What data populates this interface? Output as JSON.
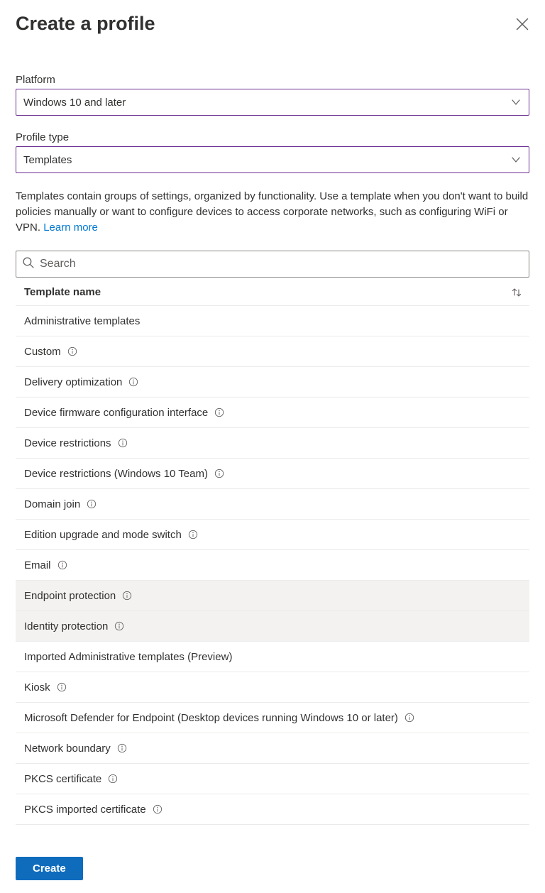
{
  "header": {
    "title": "Create a profile"
  },
  "fields": {
    "platform_label": "Platform",
    "platform_value": "Windows 10 and later",
    "profile_type_label": "Profile type",
    "profile_type_value": "Templates"
  },
  "description": {
    "text": "Templates contain groups of settings, organized by functionality. Use a template when you don't want to build policies manually or want to configure devices to access corporate networks, such as configuring WiFi or VPN. ",
    "learn_more": "Learn more"
  },
  "search": {
    "placeholder": "Search"
  },
  "table": {
    "column_header": "Template name",
    "rows": [
      {
        "label": "Administrative templates",
        "info": false,
        "highlight": false
      },
      {
        "label": "Custom",
        "info": true,
        "highlight": false
      },
      {
        "label": "Delivery optimization",
        "info": true,
        "highlight": false
      },
      {
        "label": "Device firmware configuration interface",
        "info": true,
        "highlight": false
      },
      {
        "label": "Device restrictions",
        "info": true,
        "highlight": false
      },
      {
        "label": "Device restrictions (Windows 10 Team)",
        "info": true,
        "highlight": false
      },
      {
        "label": "Domain join",
        "info": true,
        "highlight": false
      },
      {
        "label": "Edition upgrade and mode switch",
        "info": true,
        "highlight": false
      },
      {
        "label": "Email",
        "info": true,
        "highlight": false
      },
      {
        "label": "Endpoint protection",
        "info": true,
        "highlight": true
      },
      {
        "label": "Identity protection",
        "info": true,
        "highlight": true
      },
      {
        "label": "Imported Administrative templates (Preview)",
        "info": false,
        "highlight": false
      },
      {
        "label": "Kiosk",
        "info": true,
        "highlight": false
      },
      {
        "label": "Microsoft Defender for Endpoint (Desktop devices running Windows 10 or later)",
        "info": true,
        "highlight": false
      },
      {
        "label": "Network boundary",
        "info": true,
        "highlight": false
      },
      {
        "label": "PKCS certificate",
        "info": true,
        "highlight": false
      },
      {
        "label": "PKCS imported certificate",
        "info": true,
        "highlight": false
      }
    ]
  },
  "footer": {
    "create_label": "Create"
  }
}
